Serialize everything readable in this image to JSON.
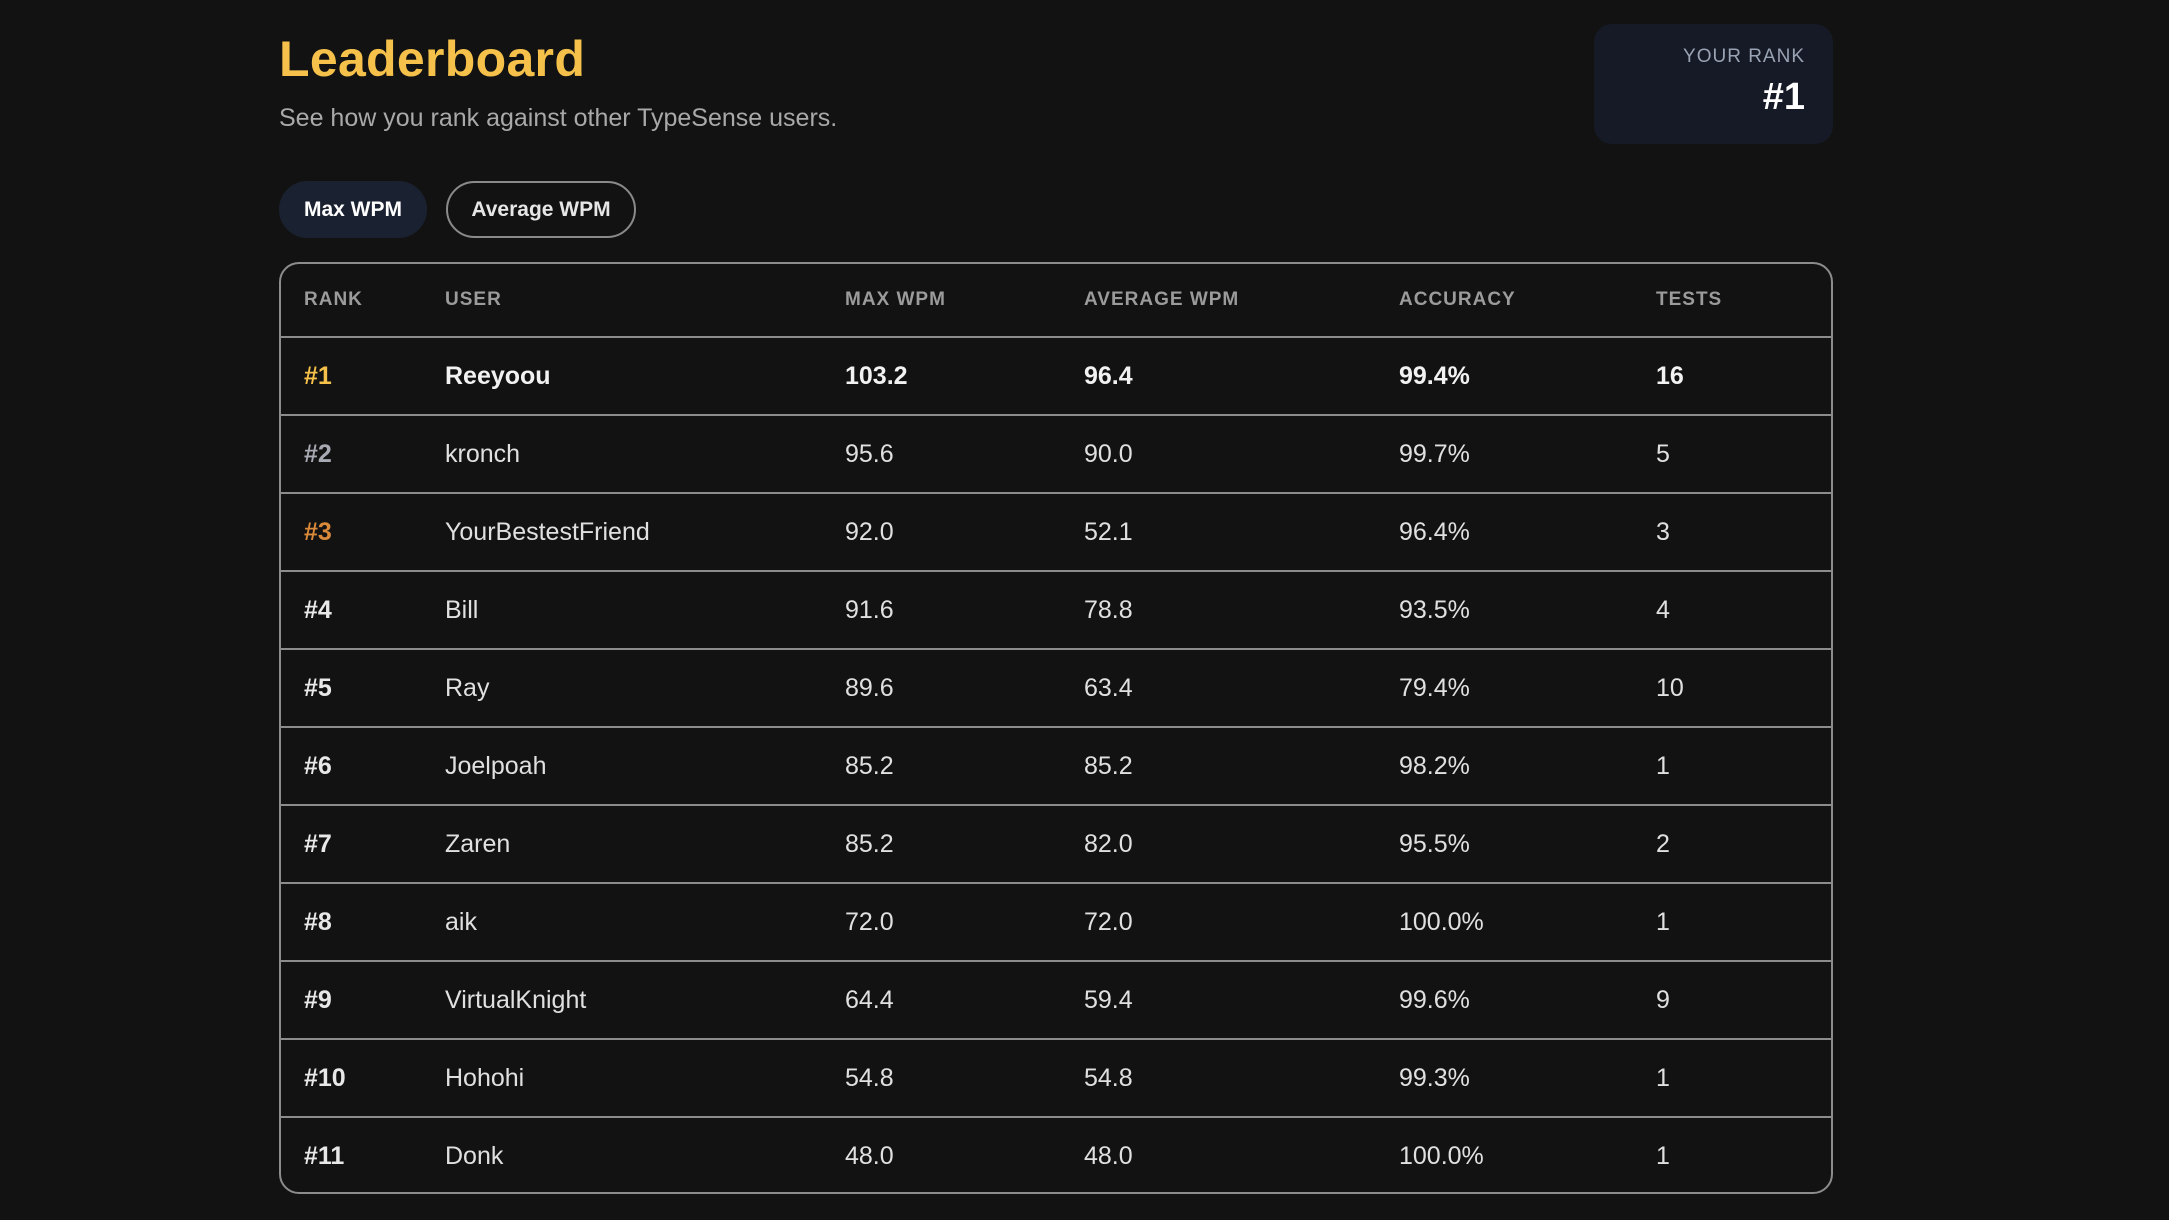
{
  "header": {
    "title": "Leaderboard",
    "subtitle": "See how you rank against other TypeSense users."
  },
  "your_rank": {
    "label": "YOUR RANK",
    "value": "#1"
  },
  "tabs": [
    {
      "label": "Max WPM",
      "active": true
    },
    {
      "label": "Average WPM",
      "active": false
    }
  ],
  "colors": {
    "gold": "#f5c14a",
    "silver": "#a8aab3",
    "bronze": "#d98a3a",
    "background": "#121212"
  },
  "table": {
    "columns": [
      "RANK",
      "USER",
      "MAX WPM",
      "AVERAGE WPM",
      "ACCURACY",
      "TESTS"
    ],
    "rows": [
      {
        "rank": "#1",
        "user": "Reeyoou",
        "max_wpm": "103.2",
        "avg_wpm": "96.4",
        "accuracy": "99.4%",
        "tests": "16",
        "medal": "gold"
      },
      {
        "rank": "#2",
        "user": "kronch",
        "max_wpm": "95.6",
        "avg_wpm": "90.0",
        "accuracy": "99.7%",
        "tests": "5",
        "medal": "silver"
      },
      {
        "rank": "#3",
        "user": "YourBestestFriend",
        "max_wpm": "92.0",
        "avg_wpm": "52.1",
        "accuracy": "96.4%",
        "tests": "3",
        "medal": "bronze"
      },
      {
        "rank": "#4",
        "user": "Bill",
        "max_wpm": "91.6",
        "avg_wpm": "78.8",
        "accuracy": "93.5%",
        "tests": "4"
      },
      {
        "rank": "#5",
        "user": "Ray",
        "max_wpm": "89.6",
        "avg_wpm": "63.4",
        "accuracy": "79.4%",
        "tests": "10"
      },
      {
        "rank": "#6",
        "user": "Joelpoah",
        "max_wpm": "85.2",
        "avg_wpm": "85.2",
        "accuracy": "98.2%",
        "tests": "1"
      },
      {
        "rank": "#7",
        "user": "Zaren",
        "max_wpm": "85.2",
        "avg_wpm": "82.0",
        "accuracy": "95.5%",
        "tests": "2"
      },
      {
        "rank": "#8",
        "user": "aik",
        "max_wpm": "72.0",
        "avg_wpm": "72.0",
        "accuracy": "100.0%",
        "tests": "1"
      },
      {
        "rank": "#9",
        "user": "VirtualKnight",
        "max_wpm": "64.4",
        "avg_wpm": "59.4",
        "accuracy": "99.6%",
        "tests": "9"
      },
      {
        "rank": "#10",
        "user": "Hohohi",
        "max_wpm": "54.8",
        "avg_wpm": "54.8",
        "accuracy": "99.3%",
        "tests": "1"
      },
      {
        "rank": "#11",
        "user": "Donk",
        "max_wpm": "48.0",
        "avg_wpm": "48.0",
        "accuracy": "100.0%",
        "tests": "1"
      }
    ]
  }
}
